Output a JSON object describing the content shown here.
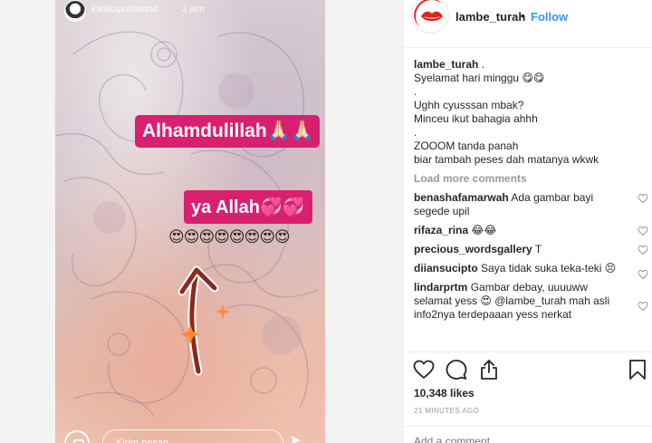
{
  "story": {
    "username": "kartikaputriworld",
    "time": "2 jam",
    "pill_1": "Alhamdulillah🙏🏻🙏🏻",
    "pill_2": "ya Allah💞💞",
    "emoji_row": "😍😍😍😍😍😍😍😍",
    "reply_placeholder": "Kirim pesan"
  },
  "post": {
    "username": "lambe_turah",
    "separator": "•",
    "follow_label": "Follow",
    "caption": {
      "author": "lambe_turah",
      "suffix": " .",
      "lines": [
        "Syelamat hari minggu 😋😋",
        ".",
        "Ughh cyusssan mbak?",
        "Minceu ikut bahagia ahhh",
        ".",
        "ZOOOM tanda panah",
        "biar tambah peses dah matanya wkwk"
      ]
    },
    "load_more": "Load more comments",
    "comments": [
      {
        "author": "benashafamarwah",
        "text": "Ada gambar bayi segede upil"
      },
      {
        "author": "rifaza_rina",
        "text": "😂😂"
      },
      {
        "author": "precious_wordsgallery",
        "text": "T"
      },
      {
        "author": "diiansucipto",
        "text": "Saya tidak suka teka-teki 😣"
      },
      {
        "author": "lindarprtm",
        "text": "Gambar debay, uuuuww selamat yess 😍 @lambe_turah mah asli info2nya terdepaaan yess nerkat"
      }
    ],
    "likes": "10,348 likes",
    "time_ago": "21 MINUTES AGO",
    "add_comment_placeholder": "Add a comment..."
  },
  "colors": {
    "follow": "#3897f0",
    "pill": "#d8206f",
    "muted": "#999999"
  },
  "icons": [
    "heart-icon",
    "comment-icon",
    "share-icon",
    "bookmark-icon",
    "camera-icon",
    "send-icon"
  ]
}
